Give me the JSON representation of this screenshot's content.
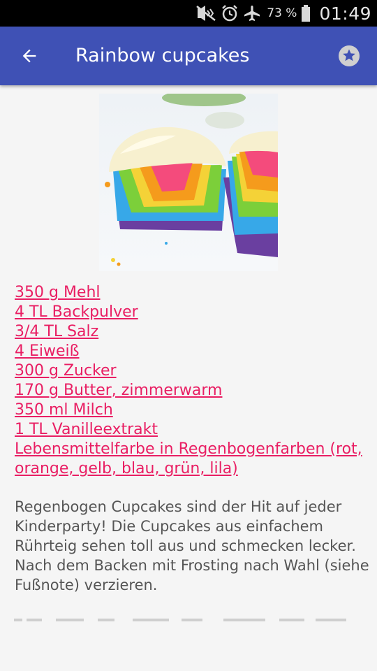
{
  "status_bar": {
    "battery_percent": "73 %",
    "time": "01:49",
    "icons": [
      "mute-icon",
      "alarm-icon",
      "airplane-mode-icon",
      "battery-icon"
    ]
  },
  "app_bar": {
    "title": "Rainbow cupcakes",
    "back_icon": "arrow-back-icon",
    "favorite_icon": "star-icon",
    "color": "#3f51b5"
  },
  "recipe": {
    "ingredients": [
      "350 g Mehl",
      "4 TL Backpulver",
      "3/4 TL Salz",
      "4 Eiweiß",
      "300 g Zucker",
      "170 g Butter, zimmerwarm",
      "350 ml Milch",
      "1 TL Vanilleextrakt",
      "Lebensmittelfarbe in Regenbogenfarben (rot, orange, gelb, blau, grün, lila)"
    ],
    "description": "Regenbogen Cupcakes sind der Hit auf jeder Kinderparty! Die Cupcakes aus einfachem Rührteig sehen toll aus und schmecken lecker. Nach dem Backen mit Frosting nach Wahl (siehe Fußnote) verzieren.",
    "link_color": "#e91e63"
  }
}
